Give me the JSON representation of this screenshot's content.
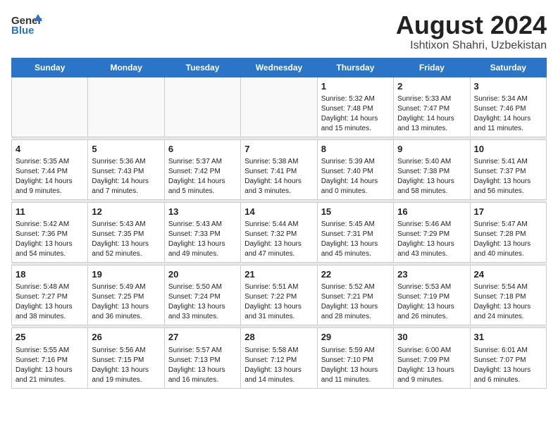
{
  "header": {
    "logo_text_general": "General",
    "logo_text_blue": "Blue",
    "month_title": "August 2024",
    "location": "Ishtixon Shahri, Uzbekistan"
  },
  "weekdays": [
    "Sunday",
    "Monday",
    "Tuesday",
    "Wednesday",
    "Thursday",
    "Friday",
    "Saturday"
  ],
  "weeks": [
    [
      {
        "day": "",
        "info": ""
      },
      {
        "day": "",
        "info": ""
      },
      {
        "day": "",
        "info": ""
      },
      {
        "day": "",
        "info": ""
      },
      {
        "day": "1",
        "info": "Sunrise: 5:32 AM\nSunset: 7:48 PM\nDaylight: 14 hours\nand 15 minutes."
      },
      {
        "day": "2",
        "info": "Sunrise: 5:33 AM\nSunset: 7:47 PM\nDaylight: 14 hours\nand 13 minutes."
      },
      {
        "day": "3",
        "info": "Sunrise: 5:34 AM\nSunset: 7:46 PM\nDaylight: 14 hours\nand 11 minutes."
      }
    ],
    [
      {
        "day": "4",
        "info": "Sunrise: 5:35 AM\nSunset: 7:44 PM\nDaylight: 14 hours\nand 9 minutes."
      },
      {
        "day": "5",
        "info": "Sunrise: 5:36 AM\nSunset: 7:43 PM\nDaylight: 14 hours\nand 7 minutes."
      },
      {
        "day": "6",
        "info": "Sunrise: 5:37 AM\nSunset: 7:42 PM\nDaylight: 14 hours\nand 5 minutes."
      },
      {
        "day": "7",
        "info": "Sunrise: 5:38 AM\nSunset: 7:41 PM\nDaylight: 14 hours\nand 3 minutes."
      },
      {
        "day": "8",
        "info": "Sunrise: 5:39 AM\nSunset: 7:40 PM\nDaylight: 14 hours\nand 0 minutes."
      },
      {
        "day": "9",
        "info": "Sunrise: 5:40 AM\nSunset: 7:38 PM\nDaylight: 13 hours\nand 58 minutes."
      },
      {
        "day": "10",
        "info": "Sunrise: 5:41 AM\nSunset: 7:37 PM\nDaylight: 13 hours\nand 56 minutes."
      }
    ],
    [
      {
        "day": "11",
        "info": "Sunrise: 5:42 AM\nSunset: 7:36 PM\nDaylight: 13 hours\nand 54 minutes."
      },
      {
        "day": "12",
        "info": "Sunrise: 5:43 AM\nSunset: 7:35 PM\nDaylight: 13 hours\nand 52 minutes."
      },
      {
        "day": "13",
        "info": "Sunrise: 5:43 AM\nSunset: 7:33 PM\nDaylight: 13 hours\nand 49 minutes."
      },
      {
        "day": "14",
        "info": "Sunrise: 5:44 AM\nSunset: 7:32 PM\nDaylight: 13 hours\nand 47 minutes."
      },
      {
        "day": "15",
        "info": "Sunrise: 5:45 AM\nSunset: 7:31 PM\nDaylight: 13 hours\nand 45 minutes."
      },
      {
        "day": "16",
        "info": "Sunrise: 5:46 AM\nSunset: 7:29 PM\nDaylight: 13 hours\nand 43 minutes."
      },
      {
        "day": "17",
        "info": "Sunrise: 5:47 AM\nSunset: 7:28 PM\nDaylight: 13 hours\nand 40 minutes."
      }
    ],
    [
      {
        "day": "18",
        "info": "Sunrise: 5:48 AM\nSunset: 7:27 PM\nDaylight: 13 hours\nand 38 minutes."
      },
      {
        "day": "19",
        "info": "Sunrise: 5:49 AM\nSunset: 7:25 PM\nDaylight: 13 hours\nand 36 minutes."
      },
      {
        "day": "20",
        "info": "Sunrise: 5:50 AM\nSunset: 7:24 PM\nDaylight: 13 hours\nand 33 minutes."
      },
      {
        "day": "21",
        "info": "Sunrise: 5:51 AM\nSunset: 7:22 PM\nDaylight: 13 hours\nand 31 minutes."
      },
      {
        "day": "22",
        "info": "Sunrise: 5:52 AM\nSunset: 7:21 PM\nDaylight: 13 hours\nand 28 minutes."
      },
      {
        "day": "23",
        "info": "Sunrise: 5:53 AM\nSunset: 7:19 PM\nDaylight: 13 hours\nand 26 minutes."
      },
      {
        "day": "24",
        "info": "Sunrise: 5:54 AM\nSunset: 7:18 PM\nDaylight: 13 hours\nand 24 minutes."
      }
    ],
    [
      {
        "day": "25",
        "info": "Sunrise: 5:55 AM\nSunset: 7:16 PM\nDaylight: 13 hours\nand 21 minutes."
      },
      {
        "day": "26",
        "info": "Sunrise: 5:56 AM\nSunset: 7:15 PM\nDaylight: 13 hours\nand 19 minutes."
      },
      {
        "day": "27",
        "info": "Sunrise: 5:57 AM\nSunset: 7:13 PM\nDaylight: 13 hours\nand 16 minutes."
      },
      {
        "day": "28",
        "info": "Sunrise: 5:58 AM\nSunset: 7:12 PM\nDaylight: 13 hours\nand 14 minutes."
      },
      {
        "day": "29",
        "info": "Sunrise: 5:59 AM\nSunset: 7:10 PM\nDaylight: 13 hours\nand 11 minutes."
      },
      {
        "day": "30",
        "info": "Sunrise: 6:00 AM\nSunset: 7:09 PM\nDaylight: 13 hours\nand 9 minutes."
      },
      {
        "day": "31",
        "info": "Sunrise: 6:01 AM\nSunset: 7:07 PM\nDaylight: 13 hours\nand 6 minutes."
      }
    ]
  ]
}
